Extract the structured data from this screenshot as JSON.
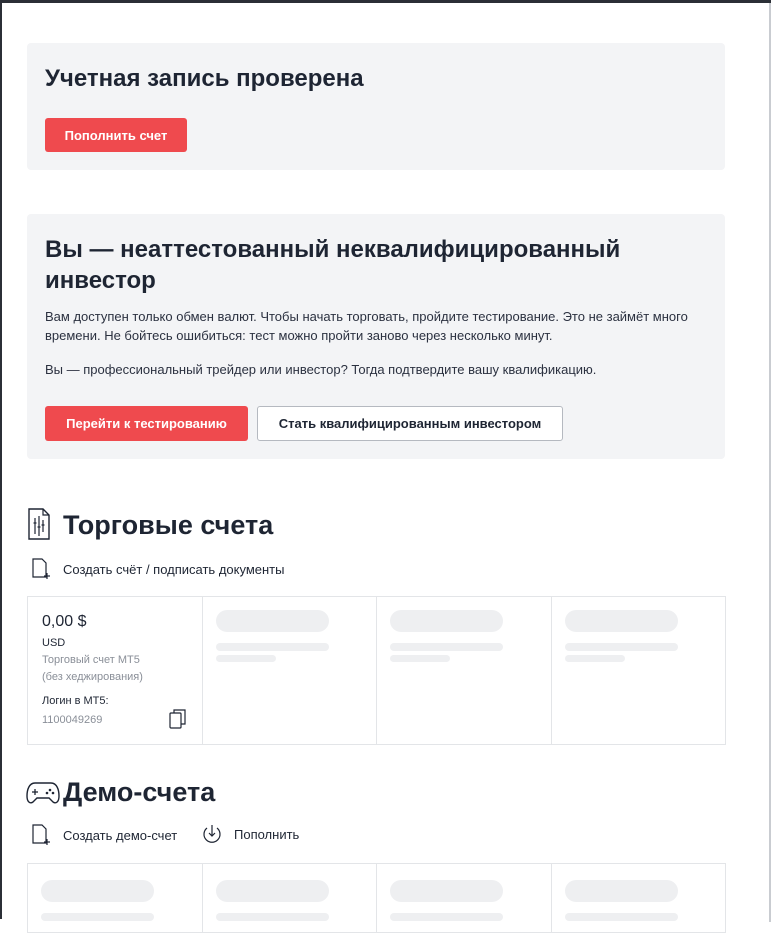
{
  "verified_card": {
    "title": "Учетная запись проверена",
    "deposit_button": "Пополнить счет"
  },
  "investor_card": {
    "title_line1": "Вы — неаттестованный неквалифицированный",
    "title_line2": "инвестор",
    "paragraph1": "Вам доступен только обмен валют. Чтобы начать торговать, пройдите тестирование. Это не займёт много времени. Не бойтесь ошибиться: тест можно пройти заново через несколько минут.",
    "paragraph2": "Вы — профессиональный трейдер или инвестор? Тогда подтвердите вашу квалификацию.",
    "test_button": "Перейти к тестированию",
    "qualify_button": "Стать квалифицированным инвестором"
  },
  "trading_accounts": {
    "title": "Торговые счета",
    "icon": "document-chart-icon",
    "create_action": "Создать счёт / подписать документы",
    "account": {
      "balance": "0,00 $",
      "currency": "USD",
      "type_line1": "Торговый счет МТ5",
      "type_line2": "(без хеджирования)",
      "login_label": "Логин в МТ5:",
      "login": "1100049269"
    }
  },
  "demo_accounts": {
    "title": "Демо-счета",
    "icon": "gamepad-icon",
    "create_action": "Создать демо-счет",
    "deposit_action": "Пополнить"
  },
  "colors": {
    "accent_red": "#ef4a4e",
    "card_bg": "#f3f4f6",
    "text_dark": "#1e2533",
    "text_muted": "#8a8f98"
  }
}
